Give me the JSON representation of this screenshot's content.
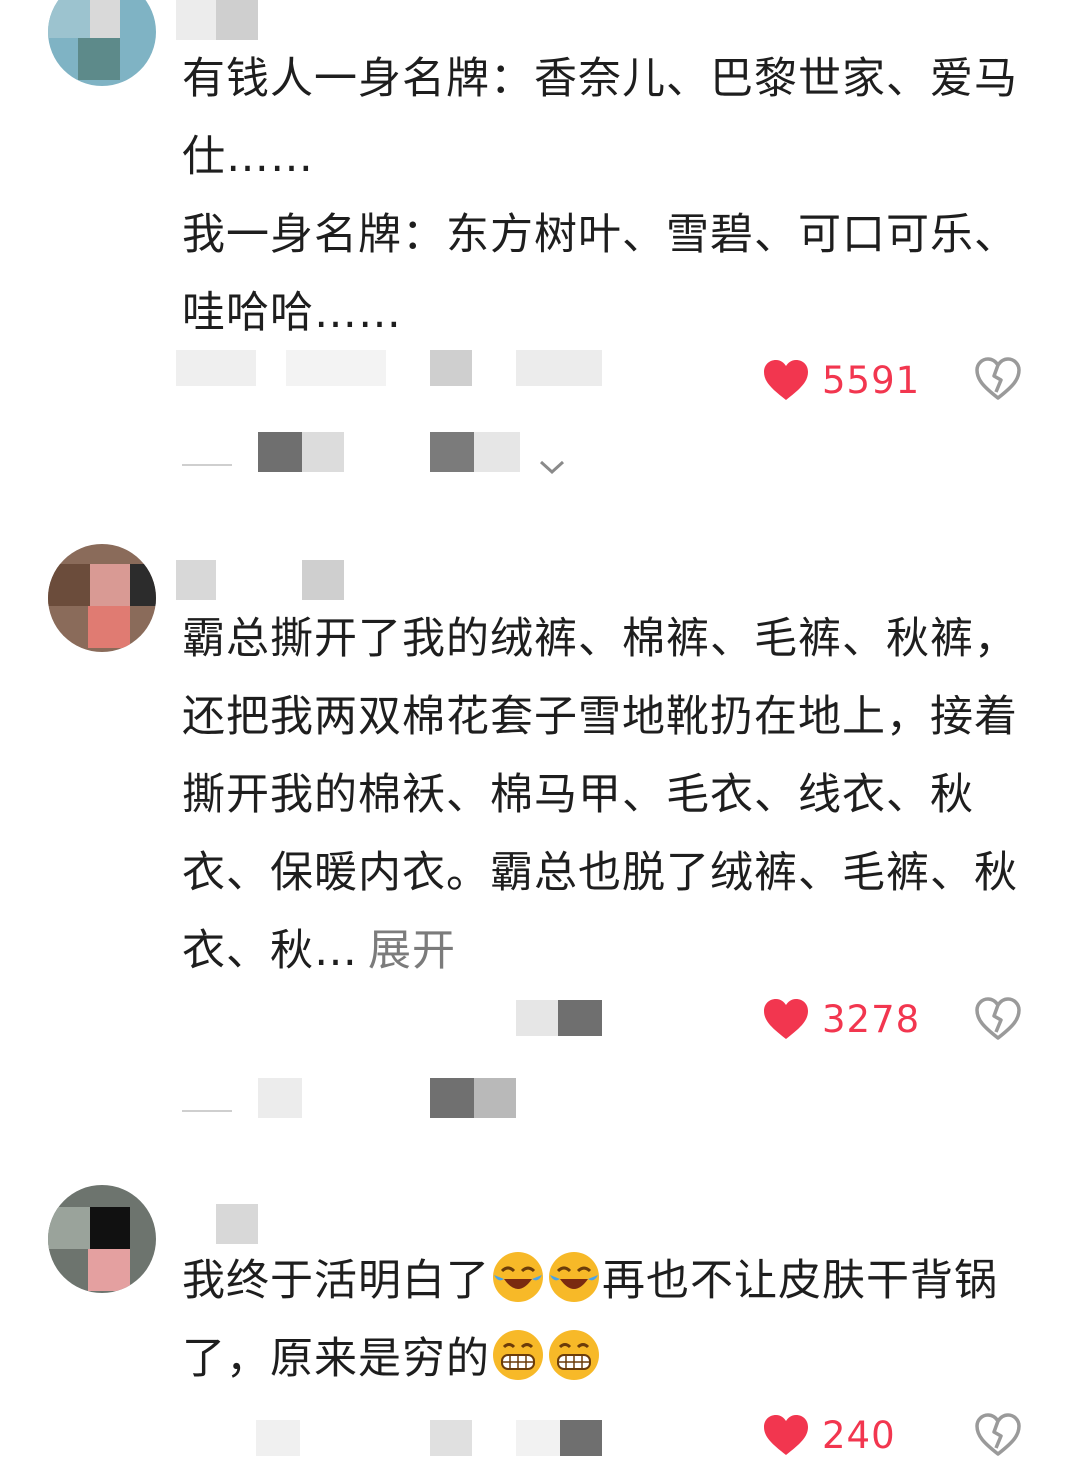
{
  "comments": [
    {
      "lines": [
        "有钱人一身名牌：香奈儿、巴黎世家、爱马仕……",
        "我一身名牌：东方树叶、雪碧、可口可乐、哇哈哈……"
      ],
      "likes": "5591",
      "like_icon": "heart-icon",
      "dislike_icon": "broken-heart-icon"
    },
    {
      "text": "霸总撕开了我的绒裤、棉裤、毛裤、秋裤，还把我两双棉花套子雪地靴扔在地上，接着撕开我的棉袄、棉马甲、毛衣、线衣、秋衣、保暖内衣。霸总也脱了绒裤、毛裤、秋衣、秋…",
      "expand_label": "展开",
      "likes": "3278"
    },
    {
      "text_part1": "我终于活明白了",
      "text_part2": "再也不让皮肤干背锅了，原来是穷的",
      "emoji_1": "laughing-crying-emoji",
      "emoji_2": "grinning-emoji",
      "likes": "240"
    }
  ],
  "colors": {
    "like": "#f2364f",
    "text": "#1e1e1e",
    "secondary": "#7b7b7b"
  }
}
